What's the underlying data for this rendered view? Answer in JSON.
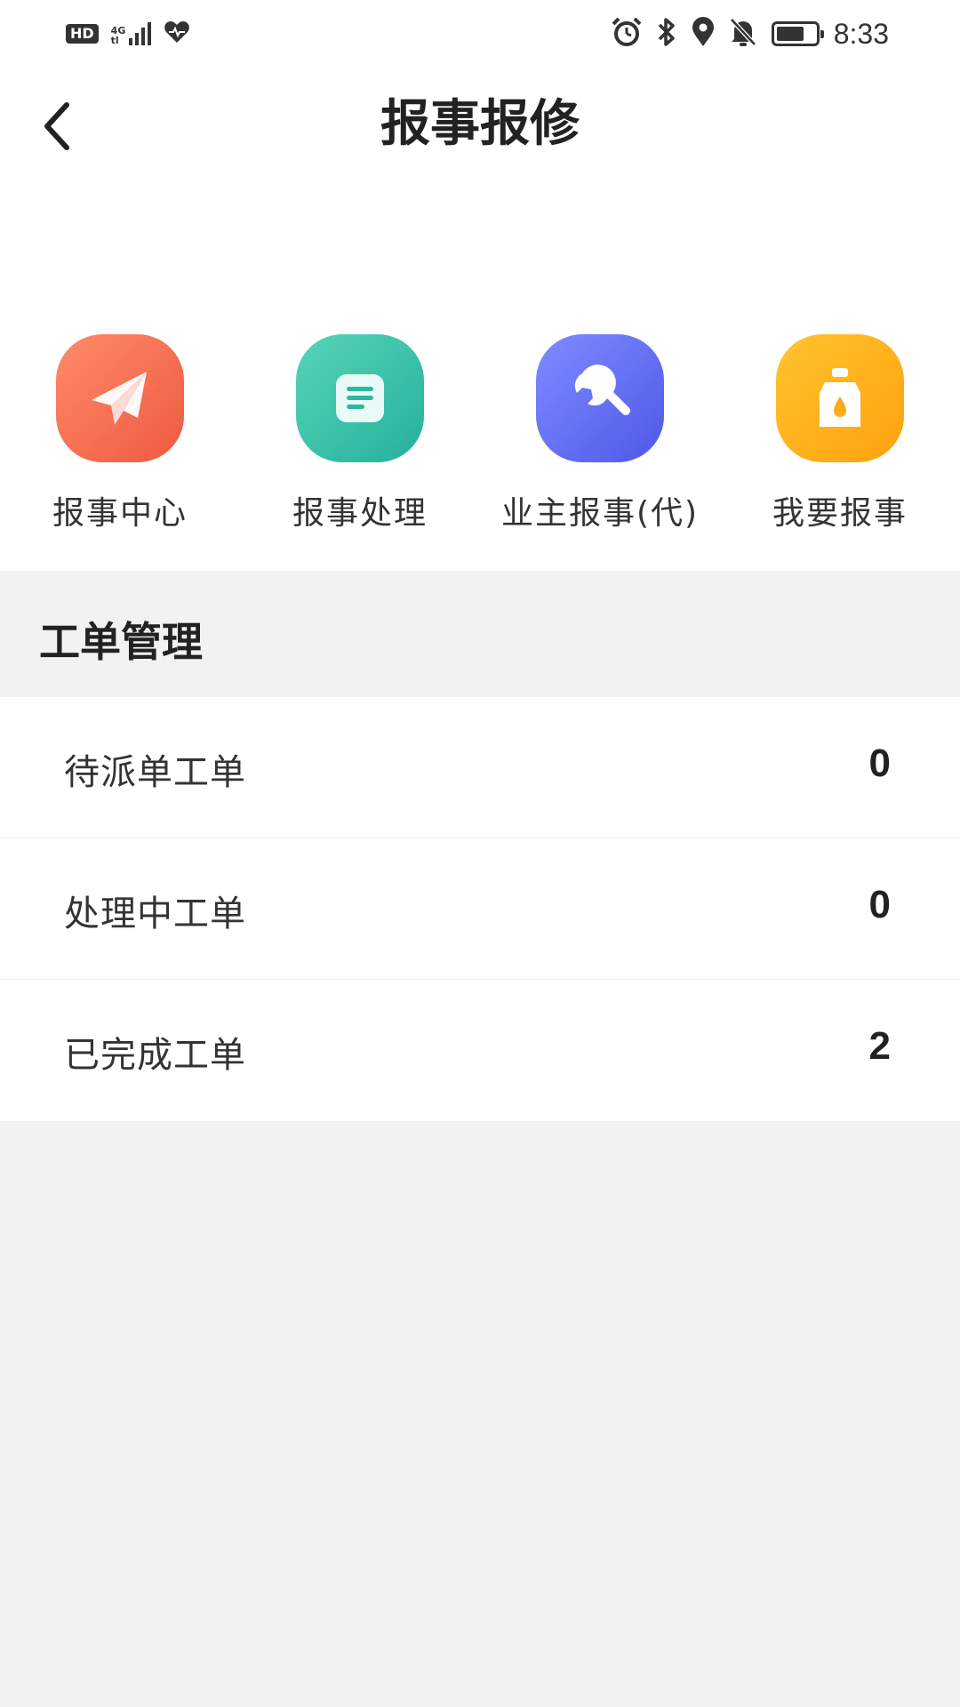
{
  "status_bar": {
    "left_badge": "HD",
    "network_top": "4G",
    "network_bottom": "tl",
    "time": "8:33",
    "icons": [
      "hd-icon",
      "signal-icon",
      "health-heart-icon",
      "alarm-icon",
      "bluetooth-icon",
      "location-icon",
      "mute-bell-icon",
      "battery-icon"
    ]
  },
  "header": {
    "title": "报事报修",
    "back_icon": "chevron-left-icon"
  },
  "quick_actions": [
    {
      "label": "报事中心",
      "icon": "paper-plane-icon",
      "color_from": "#ff8a6b",
      "color_to": "#ee5a3f"
    },
    {
      "label": "报事处理",
      "icon": "document-icon",
      "color_from": "#58d4b8",
      "color_to": "#24b09c"
    },
    {
      "label": "业主报事(代)",
      "icon": "wrench-icon",
      "color_from": "#7f8bff",
      "color_to": "#4f58e8"
    },
    {
      "label": "我要报事",
      "icon": "water-bottle-icon",
      "color_from": "#ffc42e",
      "color_to": "#ffa10e"
    }
  ],
  "section": {
    "title": "工单管理"
  },
  "orders": [
    {
      "label": "待派单工单",
      "count": "0"
    },
    {
      "label": "处理中工单",
      "count": "0"
    },
    {
      "label": "已完成工单",
      "count": "2"
    }
  ]
}
